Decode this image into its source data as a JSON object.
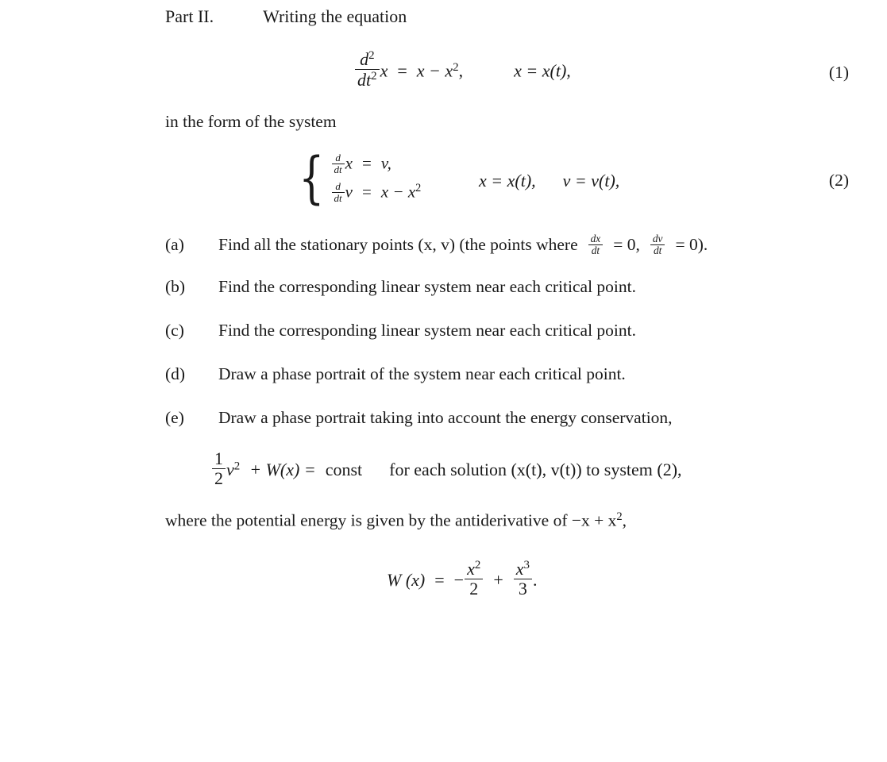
{
  "document": {
    "part_label": "Part II.",
    "part_title": "Writing the equation",
    "intro_line": "in the form of the system"
  },
  "equation1": {
    "number": "(1)",
    "lhs_numerator": "d",
    "lhs_numerator_exp": "2",
    "lhs_denominator": "dt",
    "lhs_denominator_exp": "2",
    "lhs_var": "x",
    "equals": "=",
    "rhs": "x − x",
    "rhs_exp": "2",
    "comma": ",",
    "condition": "x = x(t),"
  },
  "equation2": {
    "number": "(2)",
    "row1": {
      "frac_num": "d",
      "frac_den": "dt",
      "var": "x",
      "equals": "=",
      "rhs": "v,"
    },
    "row2": {
      "frac_num": "d",
      "frac_den": "dt",
      "var": "v",
      "equals": "=",
      "rhs": "x − x",
      "rhs_exp": "2"
    },
    "side_conditions": "x = x(t),    v = v(t),",
    "side_first": "x = x(t),",
    "side_second": "v = v(t),"
  },
  "items": [
    {
      "marker": "(a)",
      "text_before": "Find all the stationary points (x, v) (the points where",
      "frac1_num": "dx",
      "frac1_den": "dt",
      "mid": "= 0,",
      "frac2_num": "dv",
      "frac2_den": "dt",
      "text_after": "= 0)."
    },
    {
      "marker": "(b)",
      "text": "Find the corresponding linear system near each critical point."
    },
    {
      "marker": "(c)",
      "text": "Find the corresponding linear system near each critical point."
    },
    {
      "marker": "(d)",
      "text": "Draw a phase portrait of the system near each critical point."
    },
    {
      "marker": "(e)",
      "text": "Draw a phase portrait taking into account the energy conservation,"
    }
  ],
  "energy_equation": {
    "frac_num": "1",
    "frac_den": "2",
    "var": "v",
    "var_exp": "2",
    "plus": "+ W(x) =",
    "const": "const",
    "tail": "for each solution (x(t), v(t)) to system (2),"
  },
  "potential_line": {
    "text_before": "where the potential energy is given by the antiderivative of −x + x",
    "exp": "2",
    "text_after": ","
  },
  "w_equation": {
    "lhs": "W (x)",
    "equals": "=",
    "minus": "−",
    "frac1_num": "x",
    "frac1_num_exp": "2",
    "frac1_den": "2",
    "plus": "+",
    "frac2_num": "x",
    "frac2_num_exp": "3",
    "frac2_den": "3",
    "period": "."
  },
  "colors": {
    "background": "#ffffff",
    "text": "#1a1a1a"
  }
}
